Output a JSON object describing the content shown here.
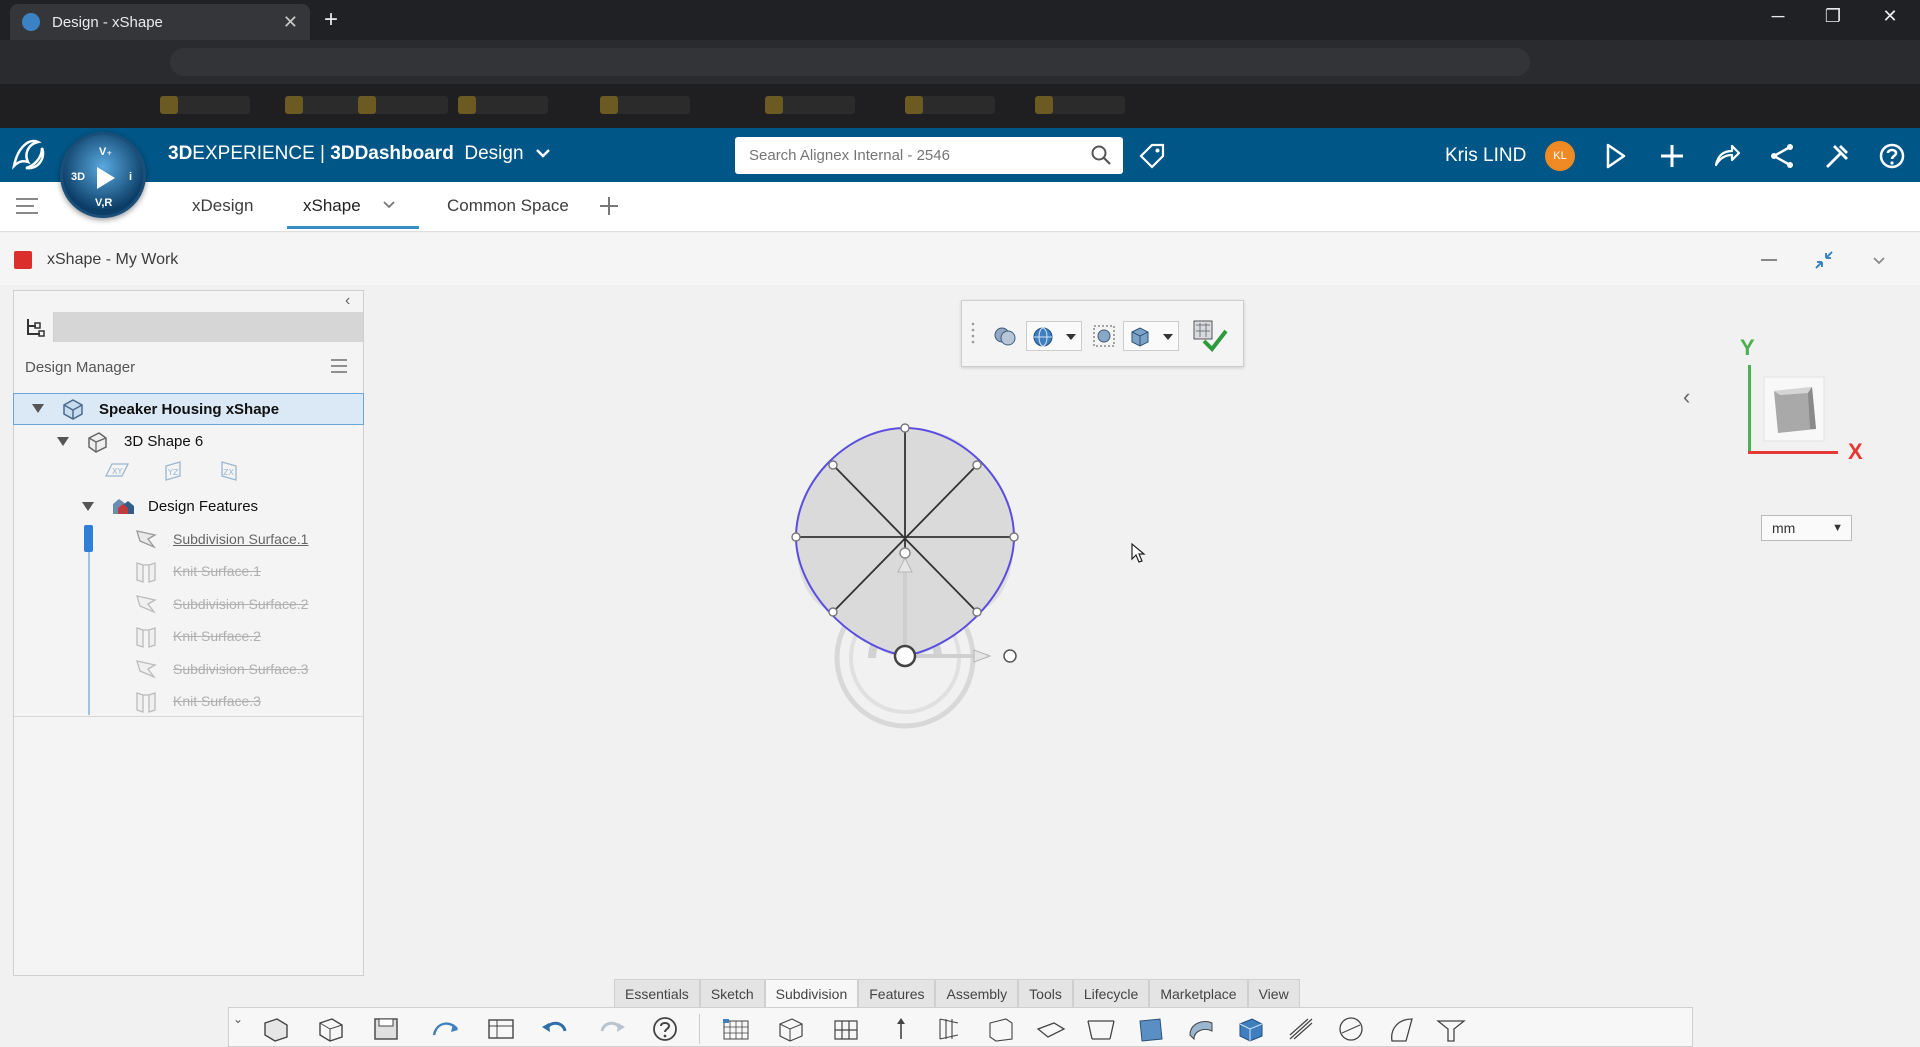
{
  "browser": {
    "tab_title": "Design - xShape",
    "close": "✕",
    "new_tab": "+",
    "min": "─",
    "restore": "❐",
    "close_win": "✕"
  },
  "topbar": {
    "brand_bold": "3D",
    "brand_rest": "EXPERIENCE | ",
    "brand_dashboard": "3DDashboard",
    "brand_app": "Design",
    "search_placeholder": "Search Alignex Internal - 2546",
    "user_name": "Kris LIND",
    "avatar_initials": "KL"
  },
  "compass": {
    "top": "V₊",
    "left": "3D",
    "right": "i",
    "bottom": "V,R"
  },
  "app_tabs": [
    {
      "label": "xDesign"
    },
    {
      "label": "xShape"
    },
    {
      "label": "Common Space"
    }
  ],
  "widget": {
    "title": "xShape - My Work"
  },
  "design_manager": {
    "title": "Design Manager",
    "root": "Speaker Housing xShape",
    "shape": "3D Shape 6",
    "planes": [
      "XY",
      "YZ",
      "ZX"
    ],
    "features_folder": "Design Features",
    "features": [
      {
        "label": "Subdivision Surface.1",
        "active": true
      },
      {
        "label": "Knit Surface.1",
        "active": false
      },
      {
        "label": "Subdivision Surface.2",
        "active": false
      },
      {
        "label": "Knit Surface.2",
        "active": false
      },
      {
        "label": "Subdivision Surface.3",
        "active": false
      },
      {
        "label": "Knit Surface.3",
        "active": false
      }
    ]
  },
  "viewport": {
    "axis_y": "Y",
    "axis_x": "X",
    "unit": "mm",
    "back": "‹"
  },
  "action_tabs": [
    "Essentials",
    "Sketch",
    "Subdivision",
    "Features",
    "Assembly",
    "Tools",
    "Lifecycle",
    "Marketplace",
    "View"
  ],
  "active_action_tab": "Subdivision",
  "colors": {
    "topbar": "#005686",
    "accent": "#368ec4",
    "avatar": "#f08a24",
    "selection_curve": "#5b4de0"
  }
}
